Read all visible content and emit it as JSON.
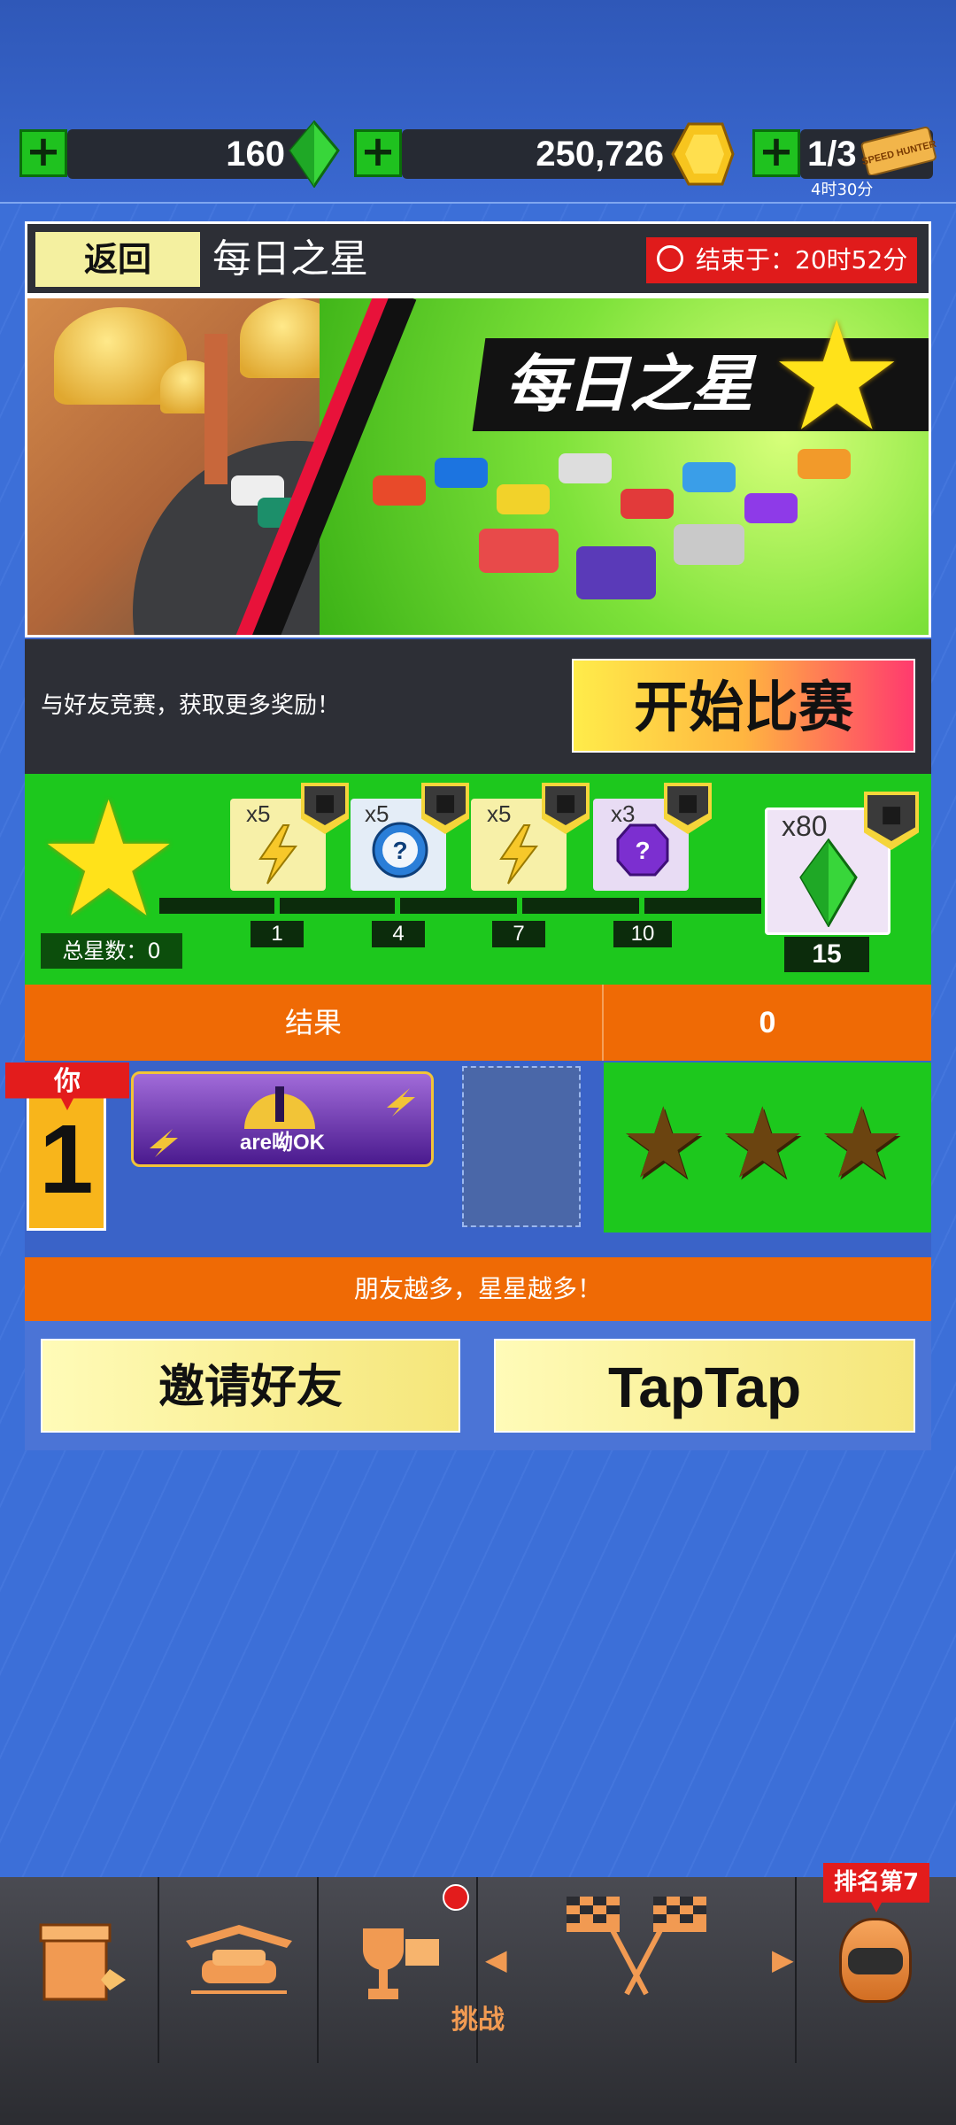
{
  "currency": {
    "gems": "160",
    "coins": "250,726",
    "tickets": "1/3",
    "ticket_timer": "4时30分",
    "ticket_label": "SPEED HUNTER"
  },
  "header": {
    "back_label": "返回",
    "title": "每日之星",
    "timer_text": "结束于：20时52分"
  },
  "banner": {
    "title": "每日之星"
  },
  "promo": {
    "text": "与好友竞赛，获取更多奖励！",
    "start_label": "开始比赛"
  },
  "rewards": {
    "total_stars": "总星数：0",
    "items": [
      {
        "count": "x5",
        "icon": "lightning-icon",
        "threshold": "1"
      },
      {
        "count": "x5",
        "icon": "mystery-coin-icon",
        "threshold": "4"
      },
      {
        "count": "x5",
        "icon": "lightning-icon",
        "threshold": "7"
      },
      {
        "count": "x3",
        "icon": "mystery-gem-icon",
        "threshold": "10"
      },
      {
        "count": "x80",
        "icon": "gem-icon",
        "threshold": "15"
      }
    ]
  },
  "results": {
    "label": "结果",
    "score": "0",
    "you_label": "你",
    "rank": "1",
    "player_name": "are呦OK"
  },
  "invite": {
    "more_friends_text": "朋友越多，星星越多！",
    "invite_label": "邀请好友",
    "taptap_label": "TapTap"
  },
  "nav": {
    "challenge_label": "挑战",
    "rank_badge": "排名第7"
  }
}
